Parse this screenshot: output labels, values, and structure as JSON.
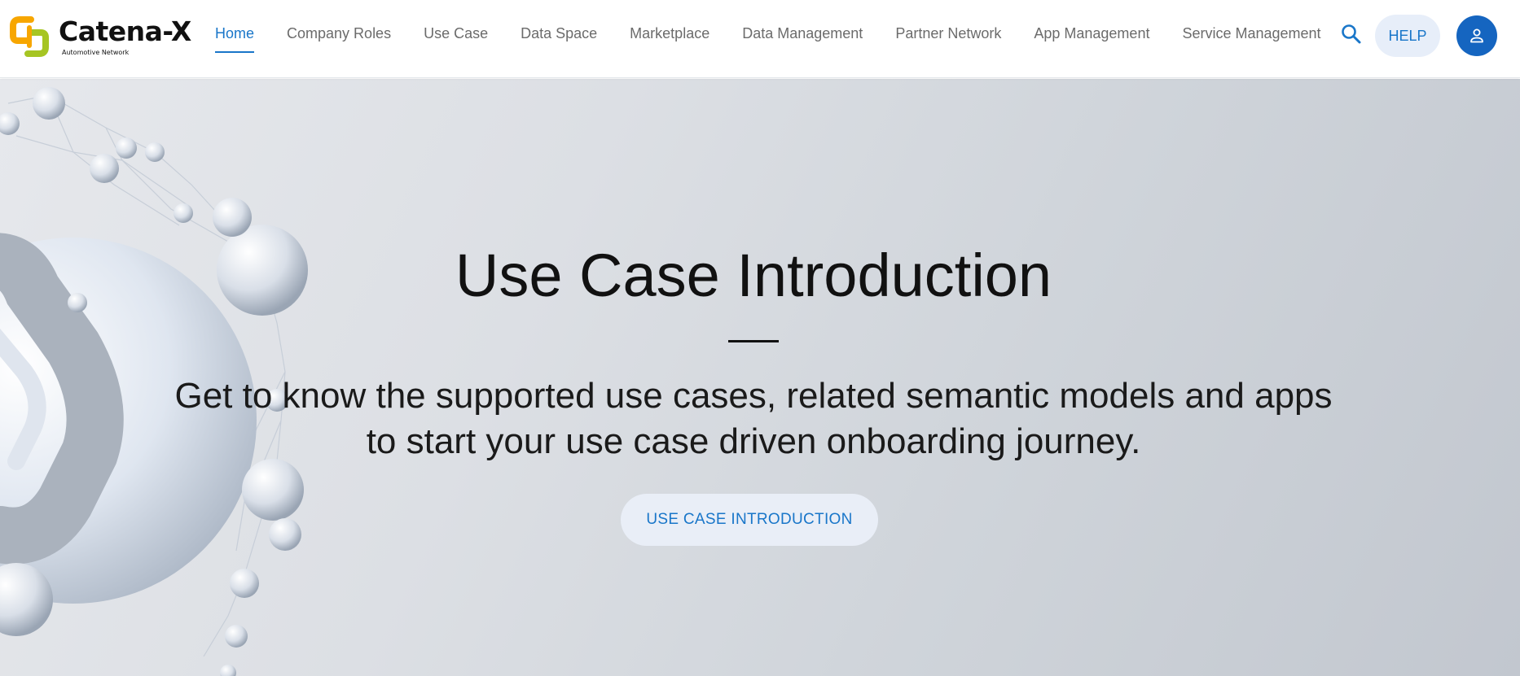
{
  "brand": {
    "name": "Catena-X",
    "tagline": "Automotive Network",
    "logo_icon": "catena-x-logo-icon",
    "colors": {
      "orange": "#f7a600",
      "green": "#a6c523"
    }
  },
  "nav": {
    "items": [
      {
        "label": "Home",
        "active": true
      },
      {
        "label": "Company Roles",
        "active": false
      },
      {
        "label": "Use Case",
        "active": false
      },
      {
        "label": "Data Space",
        "active": false
      },
      {
        "label": "Marketplace",
        "active": false
      },
      {
        "label": "Data Management",
        "active": false
      },
      {
        "label": "Partner Network",
        "active": false
      },
      {
        "label": "App Management",
        "active": false
      },
      {
        "label": "Service Management",
        "active": false
      }
    ]
  },
  "header_actions": {
    "search_icon": "search-icon",
    "help_label": "HELP",
    "user_icon": "user-icon"
  },
  "hero": {
    "title": "Use Case Introduction",
    "subtitle": "Get to know the supported use cases, related semantic models and apps to start your use case driven onboarding journey.",
    "cta_label": "USE CASE INTRODUCTION"
  },
  "colors": {
    "accent": "#1976c9",
    "avatar_bg": "#1565c0",
    "pill_bg": "#e7eef9",
    "nav_text": "#6b6b6b",
    "title_text": "#111111"
  }
}
